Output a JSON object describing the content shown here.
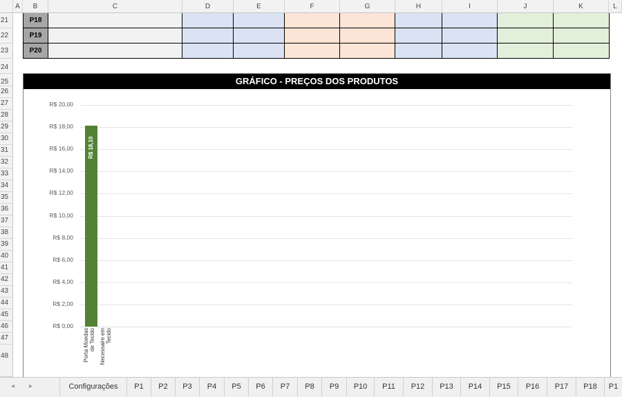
{
  "columns": [
    "A",
    "B",
    "C",
    "D",
    "E",
    "F",
    "G",
    "H",
    "I",
    "J",
    "K",
    "L"
  ],
  "row_numbers": [
    "21",
    "22",
    "23",
    "24",
    "25",
    "26",
    "27",
    "28",
    "29",
    "30",
    "31",
    "32",
    "33",
    "34",
    "35",
    "36",
    "37",
    "38",
    "39",
    "40",
    "41",
    "42",
    "43",
    "44",
    "45",
    "46",
    "47",
    "48"
  ],
  "table_rows": [
    {
      "label": "P18"
    },
    {
      "label": "P19"
    },
    {
      "label": "P20"
    }
  ],
  "colors": {
    "gray_cell": "#f2f2f2",
    "blue_cell": "#dae3f3",
    "orange_cell": "#fce4d6",
    "green_cell": "#e2efda",
    "bar": "#548235"
  },
  "chart_data": {
    "type": "bar",
    "title": "GRÁFICO - PREÇOS DOS PRODUTOS",
    "categories": [
      "Porta Moedas de Tecido",
      "Necessaire em Tecido"
    ],
    "values": [
      18.1,
      0
    ],
    "data_labels": [
      "R$ 18,10",
      ""
    ],
    "y_ticks": [
      "R$ 20,00",
      "R$ 18,00",
      "R$ 16,00",
      "R$ 14,00",
      "R$ 12,00",
      "R$ 10,00",
      "R$ 8,00",
      "R$ 6,00",
      "R$ 4,00",
      "R$ 2,00",
      "R$ 0,00"
    ],
    "ylim": [
      0,
      20
    ],
    "grid": true,
    "legend": "none",
    "xlabel": "",
    "ylabel": ""
  },
  "sheet_tabs": [
    "Configurações",
    "P1",
    "P2",
    "P3",
    "P4",
    "P5",
    "P6",
    "P7",
    "P8",
    "P9",
    "P10",
    "P11",
    "P12",
    "P13",
    "P14",
    "P15",
    "P16",
    "P17",
    "P18",
    "P1"
  ],
  "nav": {
    "prev": "◂",
    "next": "▸"
  }
}
